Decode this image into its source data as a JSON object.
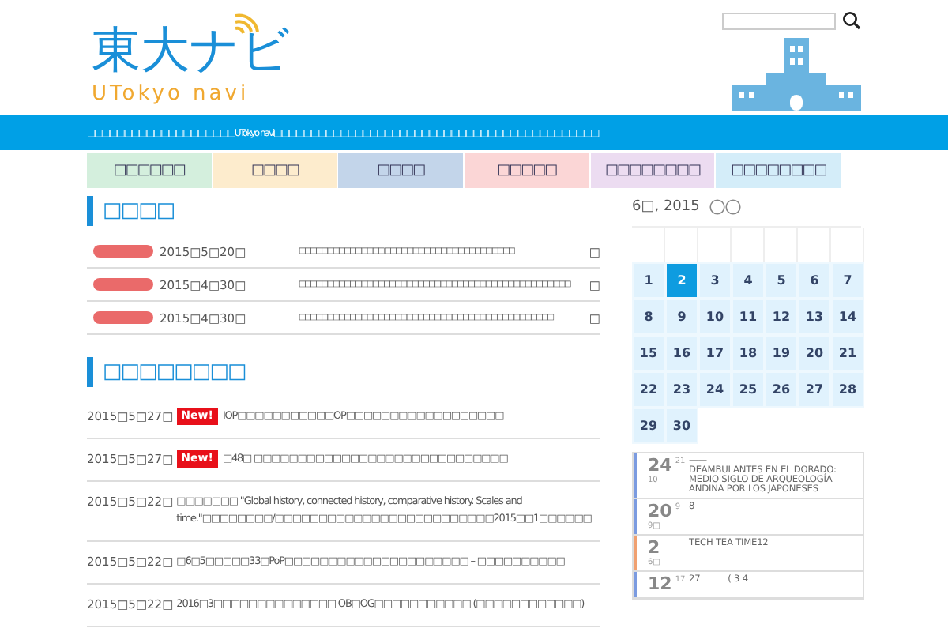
{
  "logo": {
    "title": "東大ナビ",
    "subtitle": "UTokyo navi"
  },
  "banner": "□□□□□□□□□□□□□□□□□□□□UTokyo navi□□□□□□□□□□□□□□□□□□□□□□□□□□□□□□□□□□□□□□□□□□□□",
  "nav": [
    {
      "label": "□□□□□□",
      "color": "#d4efdd"
    },
    {
      "label": "□□□□",
      "color": "#fdeccd"
    },
    {
      "label": "□□□□",
      "color": "#c3d5ea"
    },
    {
      "label": "□□□□□",
      "color": "#fbd6d6"
    },
    {
      "label": "□□□□□□□□",
      "color": "#ecdcf1"
    },
    {
      "label": "□□□□□□□□",
      "color": "#d4edf9"
    }
  ],
  "notices": {
    "title": "□□□□",
    "items": [
      {
        "date": "2015□5□20□",
        "text": "□□□□□□□□□□□□□□□ □□□□□□□□□□□□□□□□□□□□□□□",
        "mark": "□"
      },
      {
        "date": "2015□4□30□",
        "text": "□□□□□□□□□□□□□□□□□□□□□□□□□□□□□□□□□□□□□□□□□□□□□□□□",
        "mark": "□"
      },
      {
        "date": "2015□4□30□",
        "text": "□□□□□□□□□□□□□□□□□□□□□□□□□□□□□□□□□□□□□□□□□□□□□",
        "mark": "□"
      }
    ]
  },
  "news": {
    "title": "□□□□□□□□",
    "items": [
      {
        "date": "2015□5□27□",
        "new": true,
        "badge": "New!",
        "text": "IOP□□□□□□□□□□□OP□□□□□□□□□□□□□□□□□□"
      },
      {
        "date": "2015□5□27□",
        "new": true,
        "badge": "New!",
        "text": "□48□ □□□□□□□□□□□□□□□□□□□□□□□□□□□□□"
      },
      {
        "date": "2015□5□22□",
        "new": false,
        "text": "□□□□□□□ \"Global history, connected history, comparative history. Scales and time.\"□□□□□□□□/□□□□□□□□□□□□□□□□□□□□□□□□□2015□□1□□□□□□"
      },
      {
        "date": "2015□5□22□",
        "new": false,
        "text": "□6□5□□□□□33□PoP□□□□□□□□□□□□□□□□□□□□□ – □□□□□□□□□□"
      },
      {
        "date": "2015□5□22□",
        "new": false,
        "text": "2016□3□□□□□□□□□□□□□□ OB□OG□□□□□□□□□□□ (□□□□□□□□□□□□)"
      }
    ]
  },
  "calendar": {
    "month": "6□, 2015",
    "days": [
      {
        "n": "1",
        "selected": false
      },
      {
        "n": "2",
        "selected": true
      },
      {
        "n": "3",
        "selected": false
      },
      {
        "n": "4",
        "selected": false
      },
      {
        "n": "5",
        "selected": false
      },
      {
        "n": "6",
        "selected": false
      },
      {
        "n": "7",
        "selected": false
      },
      {
        "n": "8",
        "selected": false
      },
      {
        "n": "9",
        "selected": false
      },
      {
        "n": "10",
        "selected": false
      },
      {
        "n": "11",
        "selected": false
      },
      {
        "n": "12",
        "selected": false
      },
      {
        "n": "13",
        "selected": false
      },
      {
        "n": "14",
        "selected": false
      },
      {
        "n": "15",
        "selected": false
      },
      {
        "n": "16",
        "selected": false
      },
      {
        "n": "17",
        "selected": false
      },
      {
        "n": "18",
        "selected": false
      },
      {
        "n": "19",
        "selected": false
      },
      {
        "n": "20",
        "selected": false
      },
      {
        "n": "21",
        "selected": false
      },
      {
        "n": "22",
        "selected": false
      },
      {
        "n": "23",
        "selected": false
      },
      {
        "n": "24",
        "selected": false
      },
      {
        "n": "25",
        "selected": false
      },
      {
        "n": "26",
        "selected": false
      },
      {
        "n": "27",
        "selected": false
      },
      {
        "n": "28",
        "selected": false
      },
      {
        "n": "29",
        "selected": false
      },
      {
        "n": "30",
        "selected": false
      }
    ]
  },
  "events": [
    {
      "day": "24",
      "sub": "21",
      "month": "10",
      "color": "#7b9be0",
      "title": "——\nDEAMBULANTES EN EL DORADO: MEDIO SIGLO DE ARQUEOLOGÍA ANDINA POR LOS JAPONESES"
    },
    {
      "day": "20",
      "sub": "9",
      "month": "9□",
      "color": "#7b9be0",
      "title": "8"
    },
    {
      "day": "2",
      "month": "6□",
      "color": "#f0a070",
      "title": "TECH TEA TIME12"
    },
    {
      "day": "12",
      "sub": "17",
      "color": "#7b9be0",
      "title": "27          ( 3 4"
    }
  ]
}
